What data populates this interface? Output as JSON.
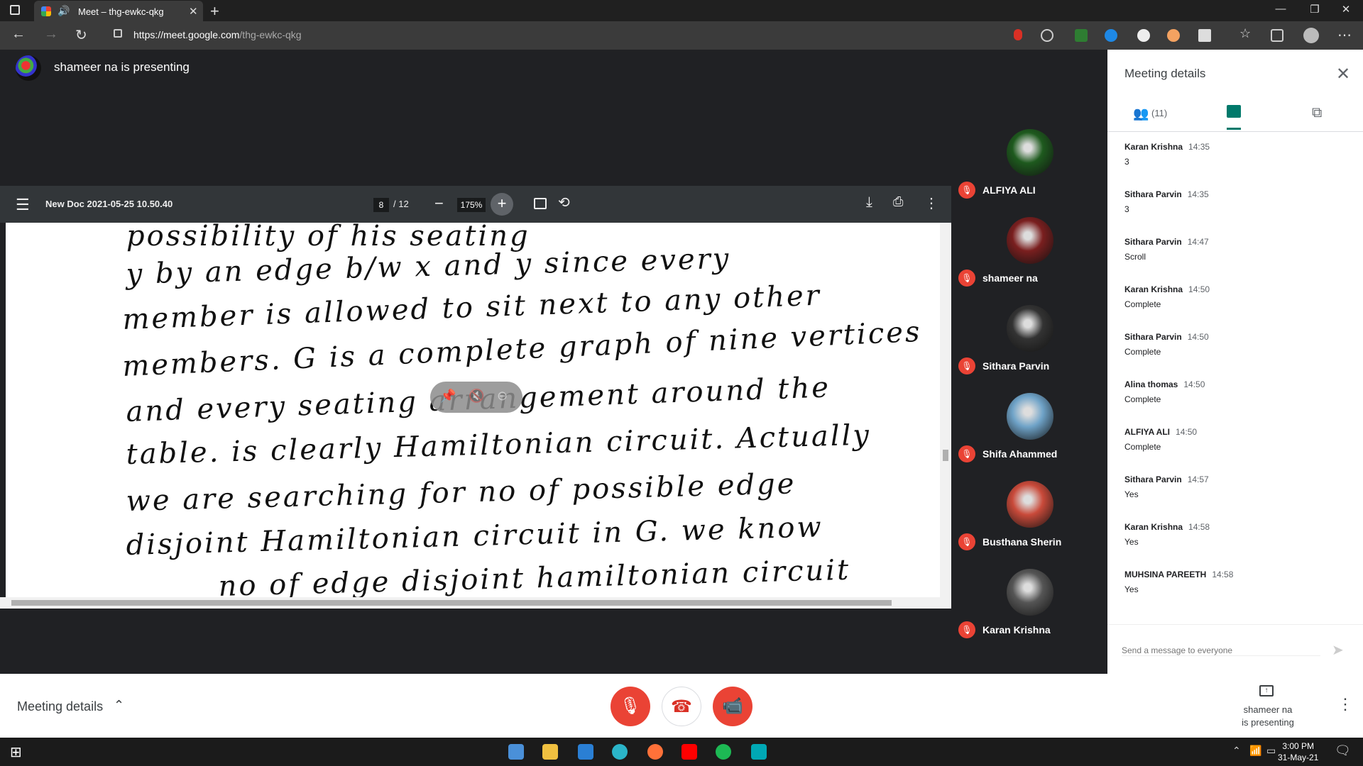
{
  "browser": {
    "tab_title": "Meet – thg-ewkc-qkg",
    "url_host": "https://meet.google.com",
    "url_path": "/thg-ewkc-qkg"
  },
  "stage": {
    "presenting_title": "shameer na is presenting"
  },
  "pdf": {
    "title": "New Doc 2021-05-25 10.50.40",
    "page_current": "8",
    "page_total": "/ 12",
    "zoom": "175%",
    "handwriting_lines": [
      "possibility of his seating",
      "y by an edge b/w x and y since every",
      "member is allowed to sit next to any other",
      "members. G is a complete graph of nine vertices",
      "and every seating arrangement around the",
      "table. is clearly Hamiltonian circuit. Actually",
      "we are searching for no of possible edge",
      "disjoint Hamiltonian circuit in G. we know",
      "no of edge disjoint hamiltonian circuit"
    ]
  },
  "participants": [
    {
      "name": "ALFIYA ALI",
      "avatar_color": "#1e5a1e"
    },
    {
      "name": "shameer na",
      "avatar_color": "#7a1f1f"
    },
    {
      "name": "Sithara Parvin",
      "avatar_color": "#333333"
    },
    {
      "name": "Shifa Ahammed",
      "avatar_color": "#6fa3c8"
    },
    {
      "name": "Busthana Sherin",
      "avatar_color": "#c94a3a"
    },
    {
      "name": "Karan Krishna",
      "avatar_color": "#555555"
    }
  ],
  "panel": {
    "title": "Meeting details",
    "people_count": "(11)",
    "messages": [
      {
        "sender": "Karan Krishna",
        "time": "14:35",
        "text": "3"
      },
      {
        "sender": "Sithara Parvin",
        "time": "14:35",
        "text": "3"
      },
      {
        "sender": "Sithara Parvin",
        "time": "14:47",
        "text": "Scroll"
      },
      {
        "sender": "Karan Krishna",
        "time": "14:50",
        "text": "Complete"
      },
      {
        "sender": "Sithara Parvin",
        "time": "14:50",
        "text": "Complete"
      },
      {
        "sender": "Alina thomas",
        "time": "14:50",
        "text": "Complete"
      },
      {
        "sender": "ALFIYA ALI",
        "time": "14:50",
        "text": "Complete"
      },
      {
        "sender": "Sithara Parvin",
        "time": "14:57",
        "text": "Yes"
      },
      {
        "sender": "Karan Krishna",
        "time": "14:58",
        "text": "Yes"
      },
      {
        "sender": "MUHSINA PAREETH",
        "time": "14:58",
        "text": "Yes"
      }
    ],
    "input_placeholder": "Send a message to everyone"
  },
  "callbar": {
    "meeting_details_label": "Meeting details",
    "present_line1": "shameer na",
    "present_line2": "is presenting"
  },
  "taskbar": {
    "time": "3:00 PM",
    "date": "31-May-21"
  },
  "colors": {
    "mic_off": "#ea4335",
    "accent": "#00796b"
  }
}
